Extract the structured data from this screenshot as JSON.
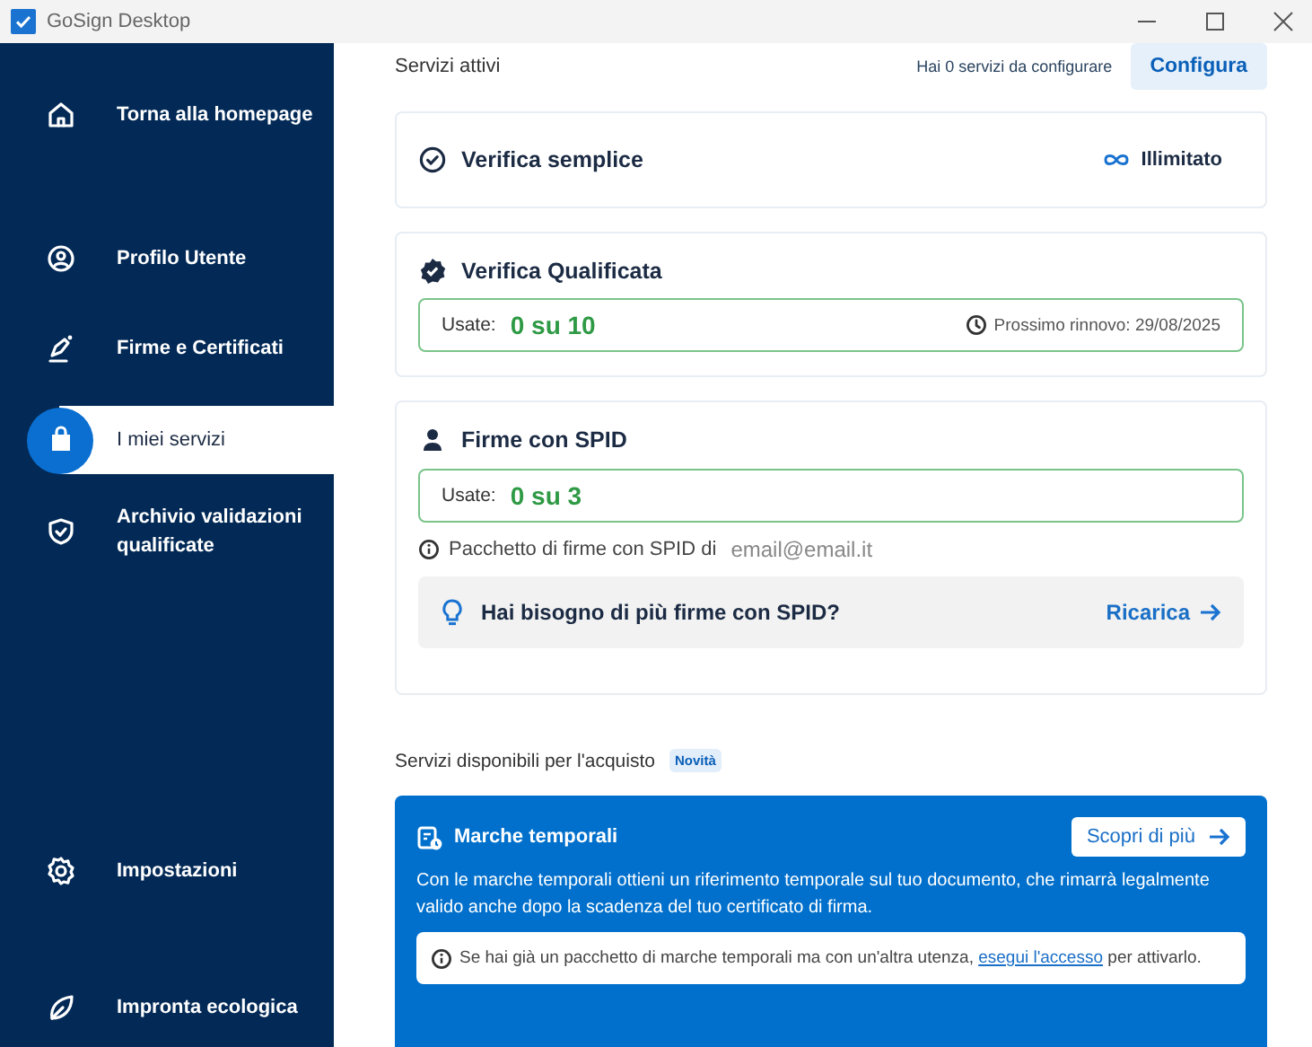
{
  "window": {
    "title": "GoSign Desktop"
  },
  "sidebar": {
    "items": [
      {
        "label": "Torna alla homepage",
        "selected": false
      },
      {
        "label": "Profilo Utente",
        "selected": false
      },
      {
        "label": "Firme e Certificati",
        "selected": false
      },
      {
        "label": "I miei servizi",
        "selected": true
      },
      {
        "label": "Archivio validazioni qualificate",
        "selected": false
      }
    ],
    "bottom_items": [
      {
        "label": "Impostazioni",
        "selected": false
      },
      {
        "label": "Impronta ecologica",
        "selected": false
      }
    ]
  },
  "active_services": {
    "heading": "Servizi attivi",
    "pending": "Hai 0 servizi da configurare",
    "configure_button": "Configura",
    "cards": [
      {
        "kind": "simple",
        "title": "Verifica semplice",
        "status": "Illimitato"
      },
      {
        "kind": "qualified",
        "title": "Verifica Qualificata",
        "usage_label": "Usate:",
        "usage_value": "0 su 10",
        "renewal": "Prossimo rinnovo: 29/08/2025"
      },
      {
        "kind": "spid",
        "title": "Firme con SPID",
        "usage_label": "Usate:",
        "usage_value": "0 su 3",
        "note": "Pacchetto di firme con SPID di",
        "email": "email@email.it",
        "promo": "Hai bisogno di più firme con SPID?",
        "promo_link": "Ricarica"
      }
    ]
  },
  "available_services": {
    "heading": "Servizi disponibili per l'acquisto",
    "badge": "Novità",
    "cards": [
      {
        "title": "Marche temporali",
        "button": "Scopri di più",
        "description": "Con le marche temporali ottieni un riferimento temporale sul tuo documento, che rimarrà legalmente valido anche dopo la scadenza del tuo certificato di firma.",
        "info": "Se hai già un pacchetto di marche temporali ma con un'altra utenza,",
        "info_link": "esegui l'accesso",
        "info_end": "per attivarlo."
      }
    ]
  }
}
